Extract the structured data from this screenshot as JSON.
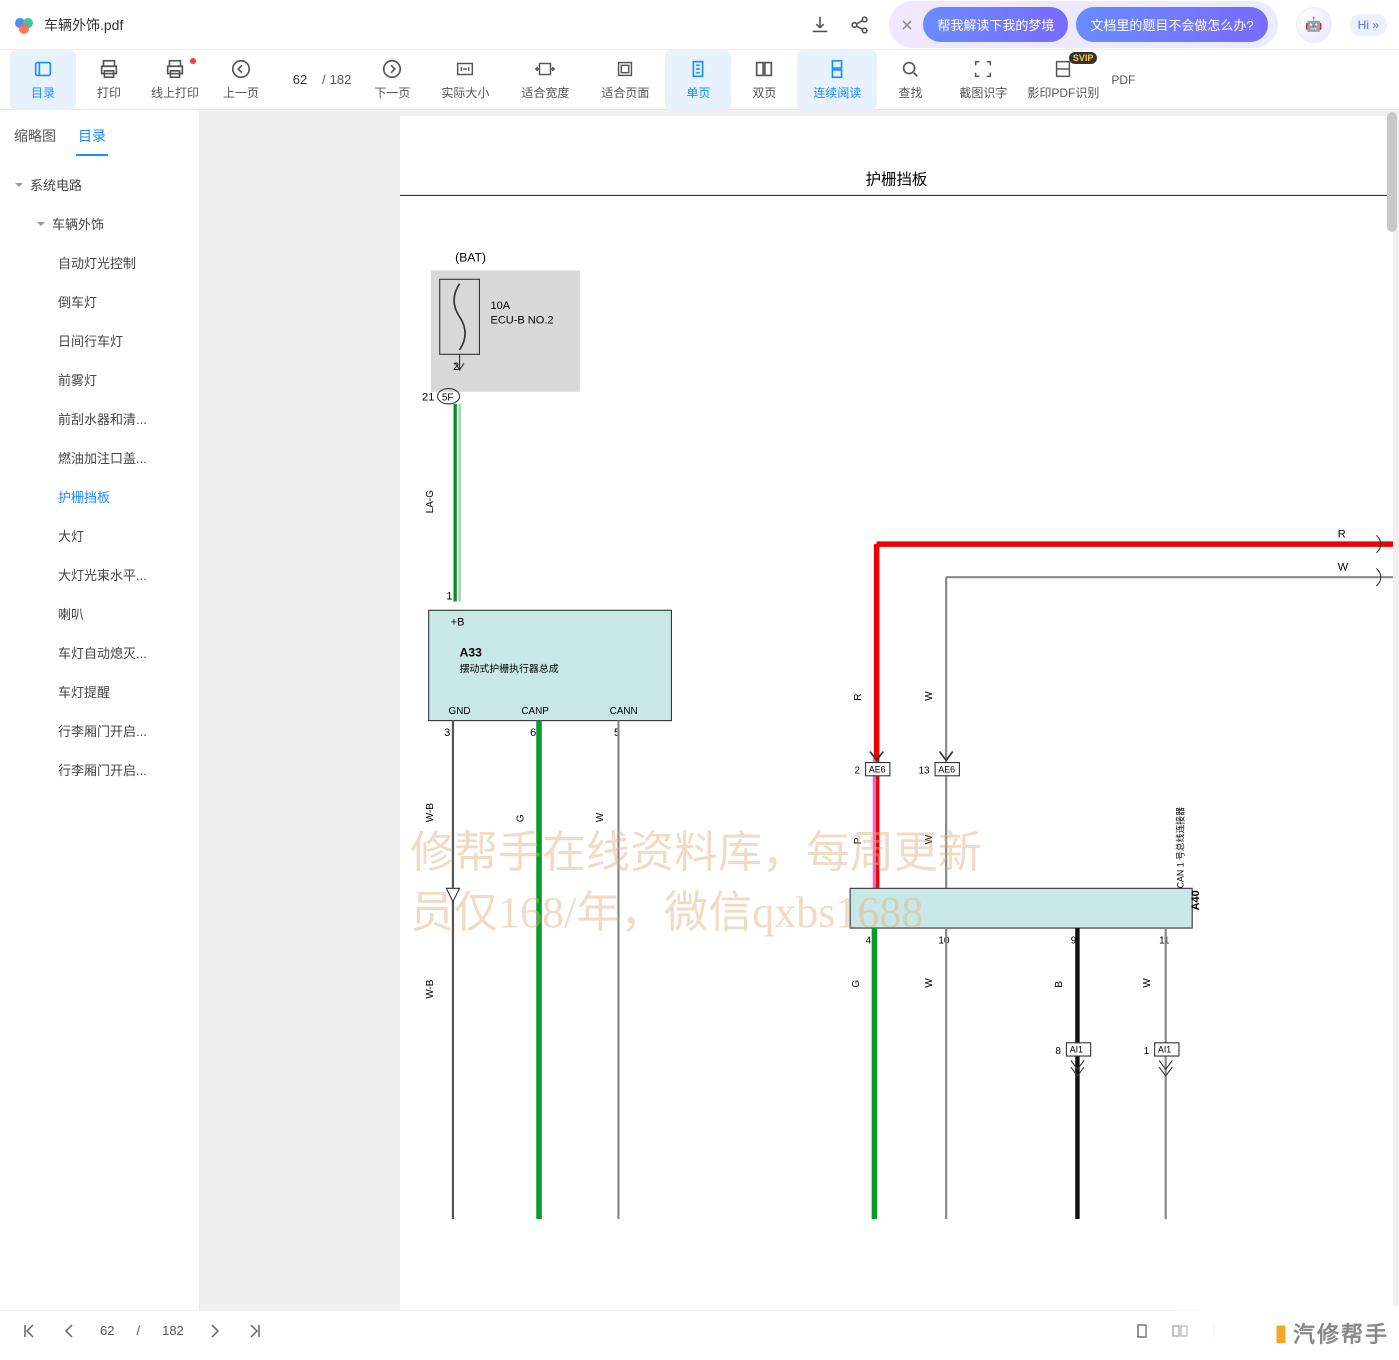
{
  "title": "车辆外饰.pdf",
  "hi_label": "Hi »",
  "pills": {
    "p1": "帮我解读下我的梦境",
    "p2": "文档里的题目不会做怎么办?"
  },
  "toolbar": {
    "catalog": "目录",
    "print": "打印",
    "online_print": "线上打印",
    "prev": "上一页",
    "next": "下一页",
    "actual": "实际大小",
    "fitw": "适合宽度",
    "fitp": "适合页面",
    "single": "单页",
    "double": "双页",
    "cont": "连续阅读",
    "find": "查找",
    "ocr": "截图识字",
    "scan": "影印PDF识别",
    "pdf": "PDF",
    "page_cur": "62",
    "page_sep": "/",
    "page_total": "182",
    "svip": "SVIP"
  },
  "side_tabs": {
    "thumb": "缩略图",
    "toc": "目录"
  },
  "toc": {
    "root": "系统电路",
    "sec": "车辆外饰",
    "items": [
      "自动灯光控制",
      "倒车灯",
      "日间行车灯",
      "前雾灯",
      "前刮水器和清...",
      "燃油加注口盖...",
      "护栅挡板",
      "大灯",
      "大灯光束水平...",
      "喇叭",
      "车灯自动熄灭...",
      "车灯提醒",
      "行李厢门开启...",
      "行李厢门开启..."
    ]
  },
  "doc": {
    "heading": "护栅挡板",
    "bat": "(BAT)",
    "fuse_a": "10A",
    "fuse_b": "ECU-B NO.2",
    "pin2": "2",
    "pin21": "21",
    "j5f": "5F",
    "wire_lag": "LA-G",
    "pin1": "1",
    "plusb": "+B",
    "a33": "A33",
    "a33_desc": "摆动式护栅执行器总成",
    "gnd": "GND",
    "canp": "CANP",
    "cann": "CANN",
    "p3": "3",
    "p6": "6",
    "p5": "5",
    "wb": "W-B",
    "g": "G",
    "w": "W",
    "p": "P",
    "r": "R",
    "b": "B",
    "ae6": "AE6",
    "p13": "13",
    "p4": "4",
    "p10": "10",
    "p9": "9",
    "p11": "11",
    "p8": "8",
    "p1b": "1",
    "a40": "A40",
    "a40_desc": "CAN 1 号总线连接器",
    "ai1": "AI1"
  },
  "watermarks": {
    "l1": "修帮手在线资料库，每周更新",
    "l2": "员仅168/年，微信qxbs1688"
  },
  "bottom": {
    "page_cur": "62",
    "page_sep": "/",
    "page_total": "182"
  },
  "brand": "汽修帮手"
}
